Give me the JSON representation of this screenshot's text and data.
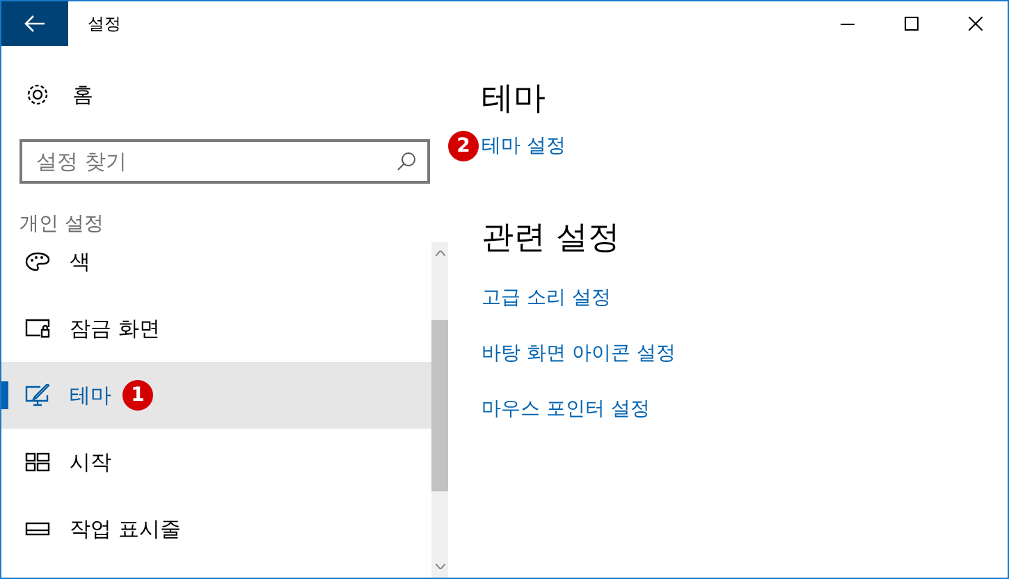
{
  "window": {
    "title": "설정"
  },
  "sidebar": {
    "home": "홈",
    "search": {
      "placeholder": "설정 찾기"
    },
    "section": "개인 설정",
    "items": [
      {
        "label": "색",
        "selected": false
      },
      {
        "label": "잠금 화면",
        "selected": false
      },
      {
        "label": "테마",
        "selected": true,
        "badge": "1"
      },
      {
        "label": "시작",
        "selected": false
      },
      {
        "label": "작업 표시줄",
        "selected": false
      }
    ]
  },
  "content": {
    "heading": "테마",
    "links": [
      {
        "label": "테마 설정",
        "badge": "2"
      }
    ],
    "related_heading": "관련 설정",
    "related_links": [
      {
        "label": "고급 소리 설정"
      },
      {
        "label": "바탕 화면 아이콘 설정"
      },
      {
        "label": "마우스 포인터 설정"
      }
    ]
  }
}
